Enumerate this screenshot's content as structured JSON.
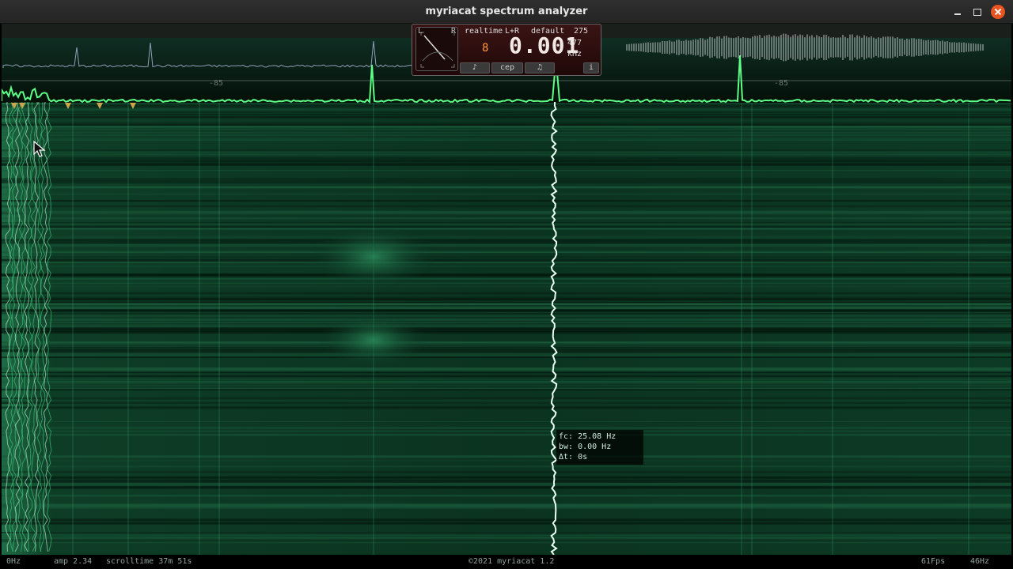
{
  "window": {
    "title": "myriacat spectrum analyzer"
  },
  "panel": {
    "mode": "realtime",
    "channel": "L+R",
    "preset": "default",
    "counter": "275",
    "small_digit": "8",
    "frequency": "0.001",
    "frequency_fine": "477",
    "unit": "kHz",
    "meter_left": "L",
    "meter_right": "R",
    "buttons": [
      "cep"
    ],
    "info_label": "i",
    "watermark": "myriacat"
  },
  "spectrum": {
    "db_label_left": "-85",
    "db_label_right": "-85"
  },
  "tooltip": {
    "fc": "fc: 25.08 Hz",
    "bw": "bw: 0.00 Hz",
    "dt": "Δt: 0s"
  },
  "statusbar": {
    "min_freq": "0Hz",
    "amp": "amp 2.34",
    "scrolltime": "scrolltime 37m 51s",
    "copyright": "©2021 myriacat 1.2",
    "fps": "61Fps",
    "max_freq": "46Hz"
  },
  "colors": {
    "accent_green": "#2ee06a",
    "waterfall_green": "#0e3b24",
    "close_button": "#e95420",
    "orange_digit": "#ff9a3c"
  }
}
